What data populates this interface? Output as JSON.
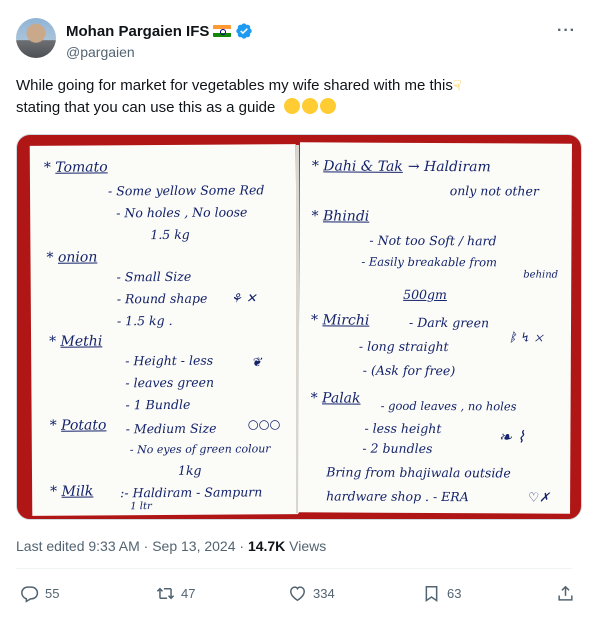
{
  "author": {
    "name": "Mohan Pargaien IFS",
    "handle": "@pargaien"
  },
  "tweet": {
    "line1": "While going for market for  vegetables my wife shared with  me this",
    "line2": "stating that you can use this as a guide"
  },
  "note_left": {
    "tomato_title": "Tomato",
    "tomato_1": "- Some yellow Some Red",
    "tomato_2": "- No holes , No loose",
    "tomato_3": "1.5 kg",
    "onion_title": "onion",
    "onion_1": "- Small Size",
    "onion_2": "- Round shape",
    "onion_3": "- 1.5 kg .",
    "methi_title": "Methi",
    "methi_1": "- Height - less",
    "methi_2": "- leaves green",
    "methi_3": "- 1 Bundle",
    "potato_title": "Potato",
    "potato_1": "- Medium Size",
    "potato_2": "- No eyes of green colour",
    "potato_3": "1kg",
    "milk_title": "Milk",
    "milk_1": ":- Haldiram - Sampurn",
    "milk_2": "1 ltr"
  },
  "note_right": {
    "dahi_title": "Dahi & Tak",
    "dahi_1": "→ Haldiram",
    "dahi_2": "only not other",
    "bhindi_title": "Bhindi",
    "bhindi_1": "- Not too Soft / hard",
    "bhindi_2": "- Easily breakable from",
    "bhindi_3": "behind",
    "bhindi_4": "500gm",
    "mirchi_title": "Mirchi",
    "mirchi_1": "- Dark green",
    "mirchi_2": "- long straight",
    "mirchi_3": "- (Ask for free)",
    "palak_title": "Palak",
    "palak_1": "- good leaves , no holes",
    "palak_2": "- less height",
    "palak_3": "- 2 bundles",
    "footer_1": "Bring from bhajiwala outside",
    "footer_2": "hardware shop . - ERA"
  },
  "meta": {
    "edited": "Last edited 9:33 AM · Sep 13, 2024 · ",
    "views_count": "14.7K",
    "views_label": " Views"
  },
  "actions": {
    "replies": "55",
    "reposts": "47",
    "likes": "334",
    "bookmarks": "63"
  },
  "colors": {
    "verified": "#1d9bf0",
    "muted": "#536471",
    "ink": "#14236a",
    "background_red": "#b01616"
  },
  "icons": [
    "more-icon",
    "verified-icon",
    "reply-icon",
    "repost-icon",
    "like-icon",
    "bookmark-icon",
    "share-icon"
  ]
}
